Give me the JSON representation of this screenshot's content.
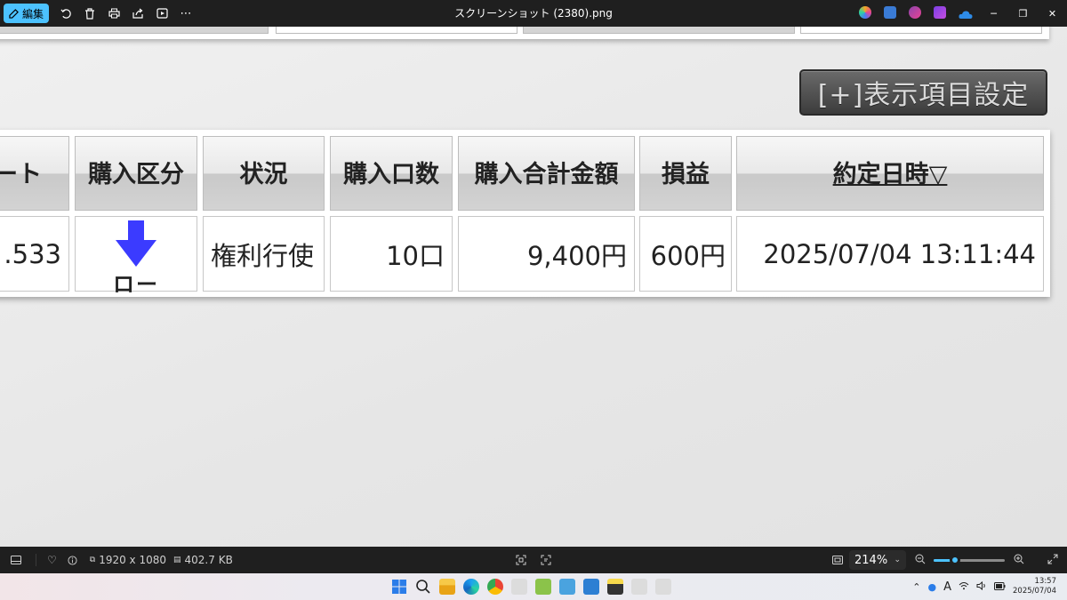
{
  "titlebar": {
    "edit_label": "編集",
    "title": "スクリーンショット (2380).png",
    "toolbar_icons": [
      "rotate-icon",
      "delete-icon",
      "print-icon",
      "share-icon",
      "slideshow-icon",
      "more-icon"
    ],
    "app_icons": [
      "copilot-icon",
      "designer-icon",
      "clipchamp-icon",
      "photos-icon",
      "onedrive-icon"
    ],
    "window_controls": [
      "minimize-icon",
      "restore-icon",
      "close-icon"
    ]
  },
  "content": {
    "settings_button": "[+]表示項目設定",
    "table": {
      "headers": [
        "ート",
        "購入区分",
        "状況",
        "購入口数",
        "購入合計金額",
        "損益",
        "約定日時▽"
      ],
      "row": {
        "rate": ".533",
        "type_label": "ロー",
        "status": "権利行使",
        "quantity": "10口",
        "total": "9,400円",
        "profit": "600円",
        "datetime": "2025/07/04 13:11:44"
      }
    },
    "colors": {
      "arrow": "#3b3bff",
      "button_bg": "#505050",
      "accent": "#4cc2ff"
    }
  },
  "statusbar": {
    "dimensions": "1920 x 1080",
    "filesize": "402.7 KB",
    "zoom": "214%",
    "zoom_slider_level": 0.3
  },
  "taskbar": {
    "time": "13:57",
    "date": "2025/07/04",
    "ime": "A"
  }
}
